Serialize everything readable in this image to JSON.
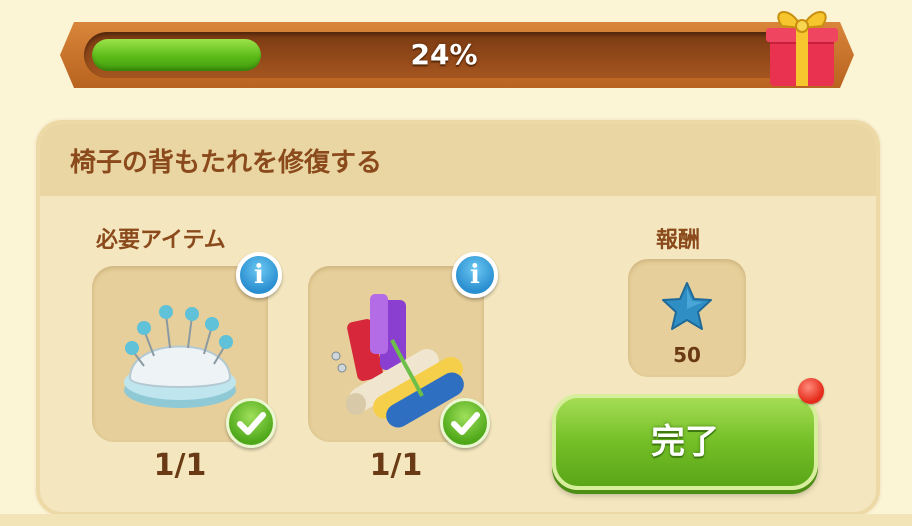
{
  "progress": {
    "percent_label": "24%",
    "fraction": 0.24
  },
  "task": {
    "title": "椅子の背もたれを修復する"
  },
  "required": {
    "label": "必要アイテム",
    "items": [
      {
        "icon": "pincushion-icon",
        "count": "1/1",
        "info": "i"
      },
      {
        "icon": "fabric-rolls-icon",
        "count": "1/1",
        "info": "i"
      }
    ]
  },
  "reward": {
    "label": "報酬",
    "icon": "blue-star-icon",
    "value": "50"
  },
  "actions": {
    "complete_label": "完了"
  },
  "colors": {
    "accent_green": "#74bf27",
    "title_brown": "#8a4a1c",
    "info_blue": "#2a8fd0",
    "notification_red": "#e52b1a"
  }
}
